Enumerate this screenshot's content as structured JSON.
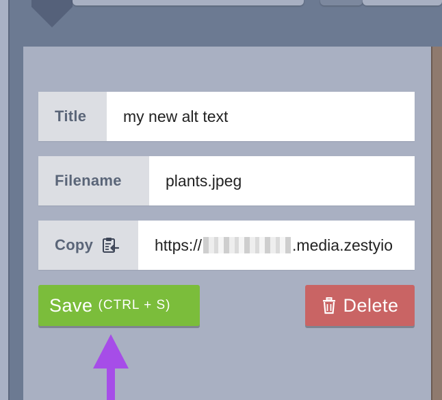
{
  "form": {
    "title_label": "Title",
    "title_value": "my new alt text",
    "filename_label": "Filename",
    "filename_value": "plants.jpeg",
    "copy_label": "Copy",
    "url_prefix": "https://",
    "url_suffix": ".media.zestyio"
  },
  "actions": {
    "save_label": "Save",
    "save_shortcut": "(CTRL + S)",
    "delete_label": "Delete"
  },
  "icons": {
    "copy": "clipboard-icon",
    "delete": "trash-icon",
    "annotation": "arrow-up-icon"
  },
  "colors": {
    "save": "#7bbd3b",
    "delete": "#c96464",
    "panel": "#a9b0c2",
    "annotation_arrow": "#a64de8"
  }
}
